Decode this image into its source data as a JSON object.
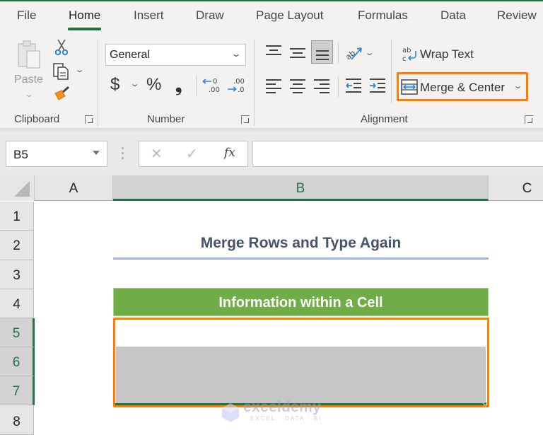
{
  "ribbon": {
    "tabs": [
      {
        "label": "File",
        "active": false
      },
      {
        "label": "Home",
        "active": true
      },
      {
        "label": "Insert",
        "active": false
      },
      {
        "label": "Draw",
        "active": false
      },
      {
        "label": "Page Layout",
        "active": false
      },
      {
        "label": "Formulas",
        "active": false
      },
      {
        "label": "Data",
        "active": false
      },
      {
        "label": "Review",
        "active": false
      }
    ],
    "clipboard": {
      "group_label": "Clipboard",
      "paste_label": "Paste",
      "icons": [
        "paste-icon",
        "cut-icon",
        "copy-icon",
        "format-painter-icon"
      ]
    },
    "number": {
      "group_label": "Number",
      "format_value": "General",
      "currency_symbol": "$",
      "percent_symbol": "%",
      "comma_symbol": "❟",
      "icons": [
        "accounting-format-icon",
        "percent-style-icon",
        "comma-style-icon",
        "increase-decimal-icon",
        "decrease-decimal-icon"
      ]
    },
    "alignment": {
      "group_label": "Alignment",
      "wrap_text_label": "Wrap Text",
      "merge_center_label": "Merge & Center",
      "active_vertical_align": "bottom-align",
      "highlight_color": "#ff8000"
    }
  },
  "formula_bar": {
    "name_box": "B5",
    "fx_label": "fx",
    "cancel_symbol": "✕",
    "enter_symbol": "✓",
    "formula_value": ""
  },
  "grid": {
    "columns": [
      {
        "label": "A",
        "selected": false
      },
      {
        "label": "B",
        "selected": true
      },
      {
        "label": "C",
        "selected": false
      }
    ],
    "rows": [
      {
        "label": "1",
        "selected": false
      },
      {
        "label": "2",
        "selected": false
      },
      {
        "label": "3",
        "selected": false
      },
      {
        "label": "4",
        "selected": false
      },
      {
        "label": "5",
        "selected": true
      },
      {
        "label": "6",
        "selected": true
      },
      {
        "label": "7",
        "selected": true
      },
      {
        "label": "8",
        "selected": false
      }
    ],
    "cells": {
      "B2": "Merge Rows and Type Again",
      "B4": "Information within a Cell",
      "B5_B7": ""
    },
    "selected_range": "B5:B7",
    "accent_color": "#217346",
    "header_fill": "#70ad47"
  },
  "watermark": {
    "name": "exceldemy",
    "tagline": "EXCEL · DATA · BI"
  }
}
